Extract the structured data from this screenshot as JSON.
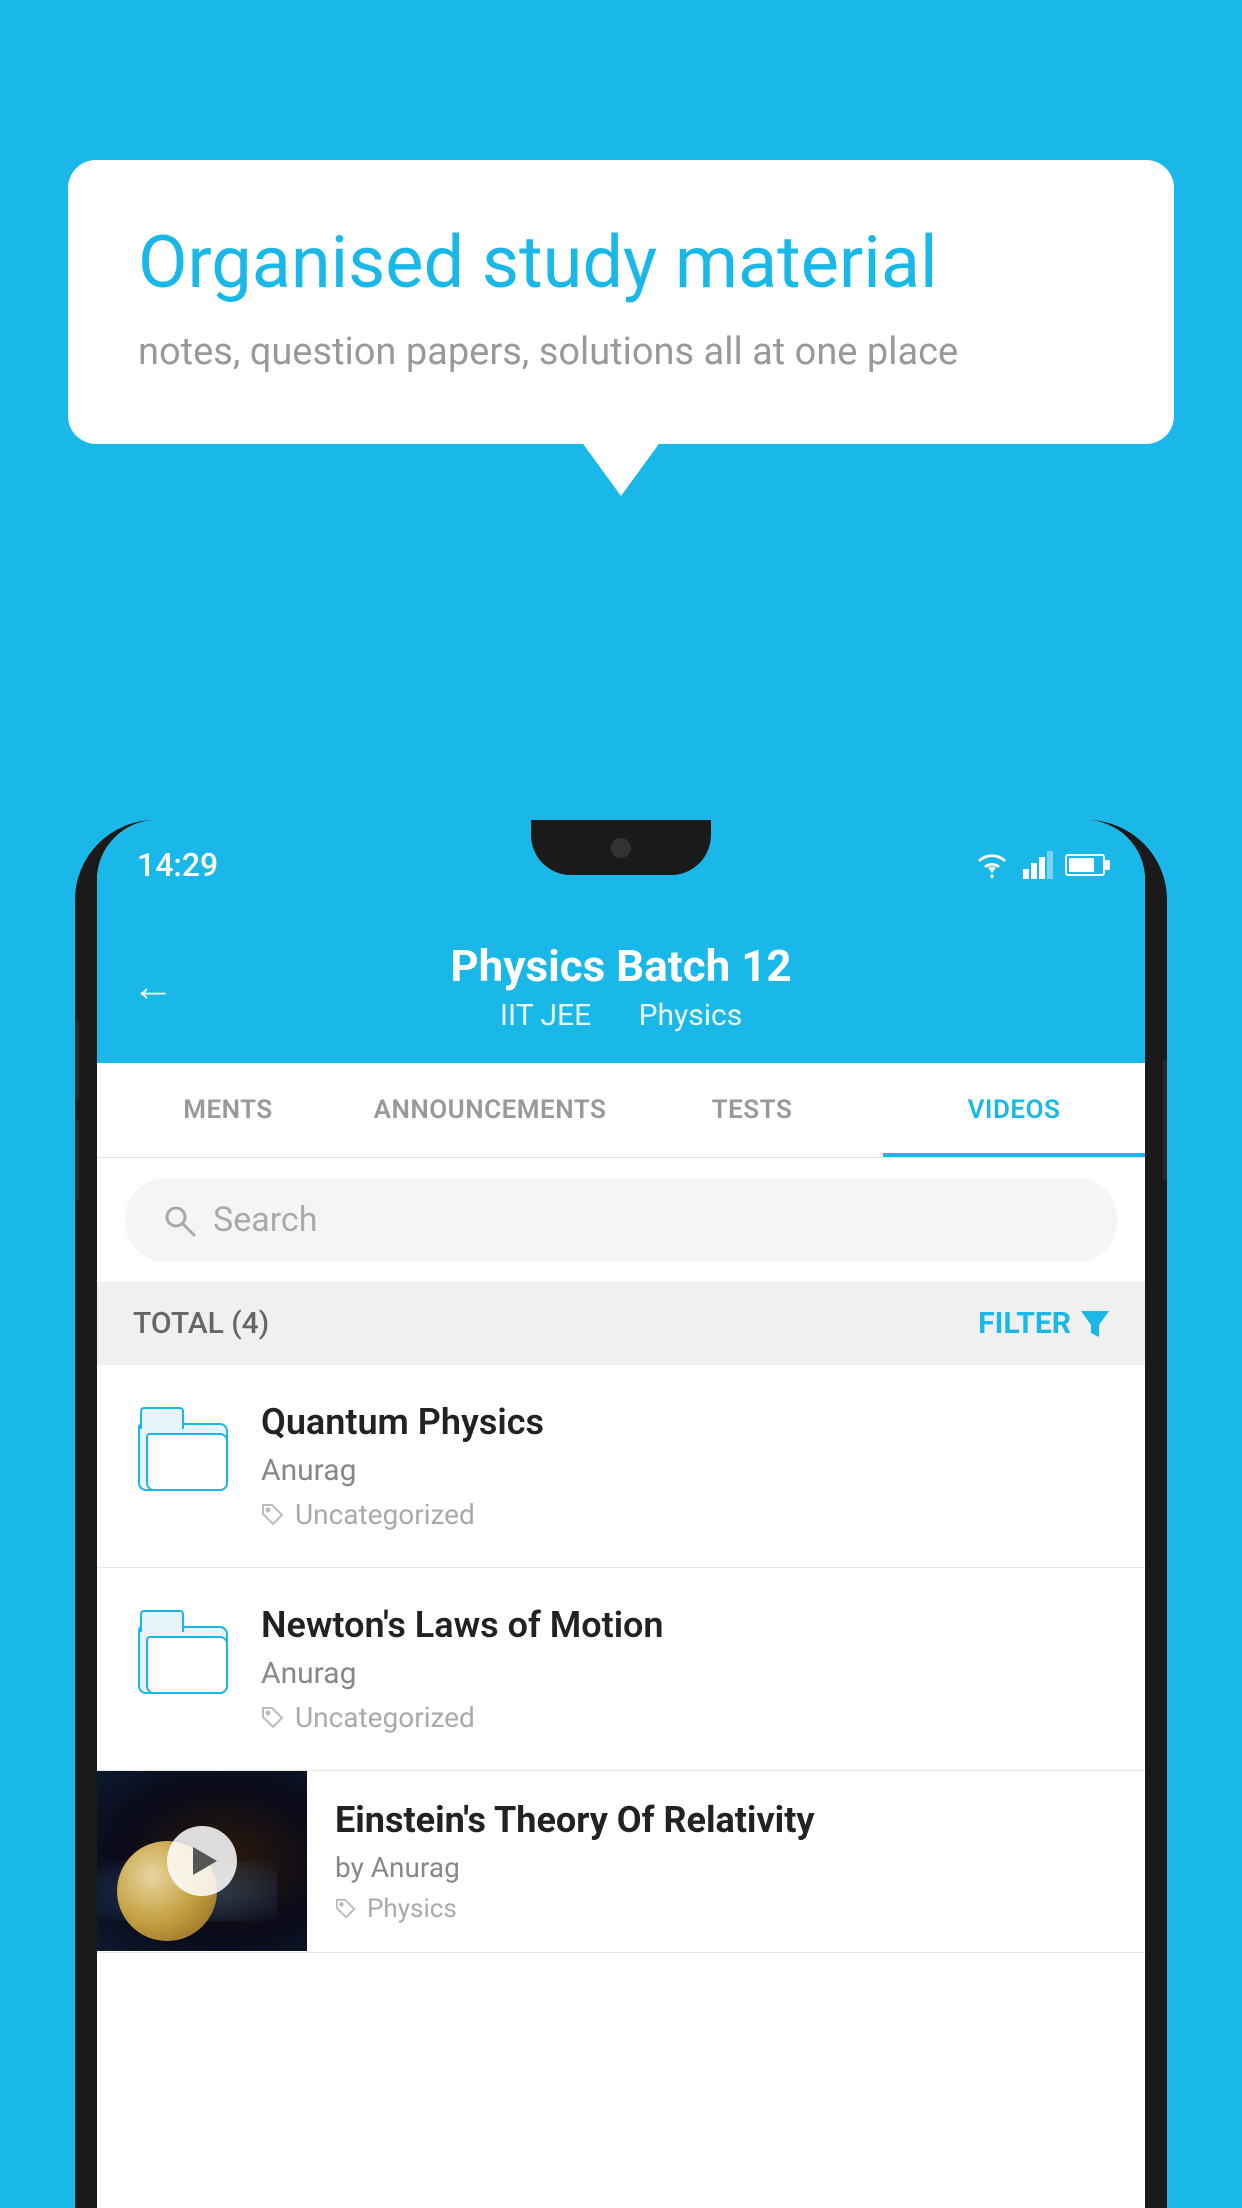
{
  "background_color": "#1ab8e8",
  "speech_bubble": {
    "title": "Organised study material",
    "subtitle": "notes, question papers, solutions all at one place"
  },
  "phone": {
    "status_bar": {
      "time": "14:29"
    },
    "header": {
      "back_label": "←",
      "title": "Physics Batch 12",
      "subtitle_tag1": "IIT JEE",
      "subtitle_tag2": "Physics"
    },
    "tabs": [
      {
        "label": "MENTS",
        "active": false
      },
      {
        "label": "ANNOUNCEMENTS",
        "active": false
      },
      {
        "label": "TESTS",
        "active": false
      },
      {
        "label": "VIDEOS",
        "active": true
      }
    ],
    "search": {
      "placeholder": "Search"
    },
    "filter_bar": {
      "total_label": "TOTAL (4)",
      "filter_label": "FILTER"
    },
    "videos": [
      {
        "id": 1,
        "title": "Quantum Physics",
        "author": "Anurag",
        "tag": "Uncategorized",
        "has_thumbnail": false
      },
      {
        "id": 2,
        "title": "Newton's Laws of Motion",
        "author": "Anurag",
        "tag": "Uncategorized",
        "has_thumbnail": false
      },
      {
        "id": 3,
        "title": "Einstein's Theory Of Relativity",
        "author": "by Anurag",
        "tag": "Physics",
        "has_thumbnail": true
      }
    ]
  }
}
